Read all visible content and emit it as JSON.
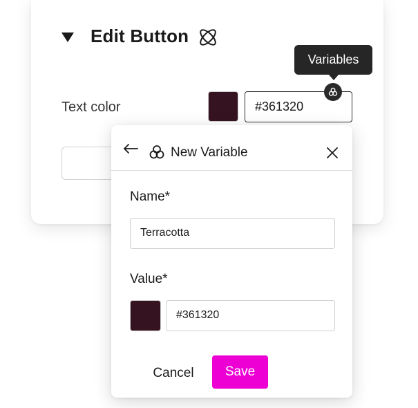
{
  "panel": {
    "title": "Edit Button",
    "text_color_label": "Text color",
    "text_color_value": "#361320",
    "swatch_color": "#361320"
  },
  "tooltip": {
    "text": "Variables"
  },
  "popover": {
    "title": "New Variable",
    "name_label": "Name*",
    "name_value": "Terracotta",
    "value_label": "Value*",
    "value_hex": "#361320",
    "swatch_color": "#361320",
    "cancel_label": "Cancel",
    "save_label": "Save"
  },
  "colors": {
    "accent": "#ec00d4",
    "tooltip_bg": "#262626",
    "text_dark": "#1a1a1a"
  },
  "icons": {
    "collapse": "triangle-down-icon",
    "atom": "atom-icon",
    "variable": "variable-icon",
    "back": "arrow-left-icon",
    "close": "close-icon"
  }
}
